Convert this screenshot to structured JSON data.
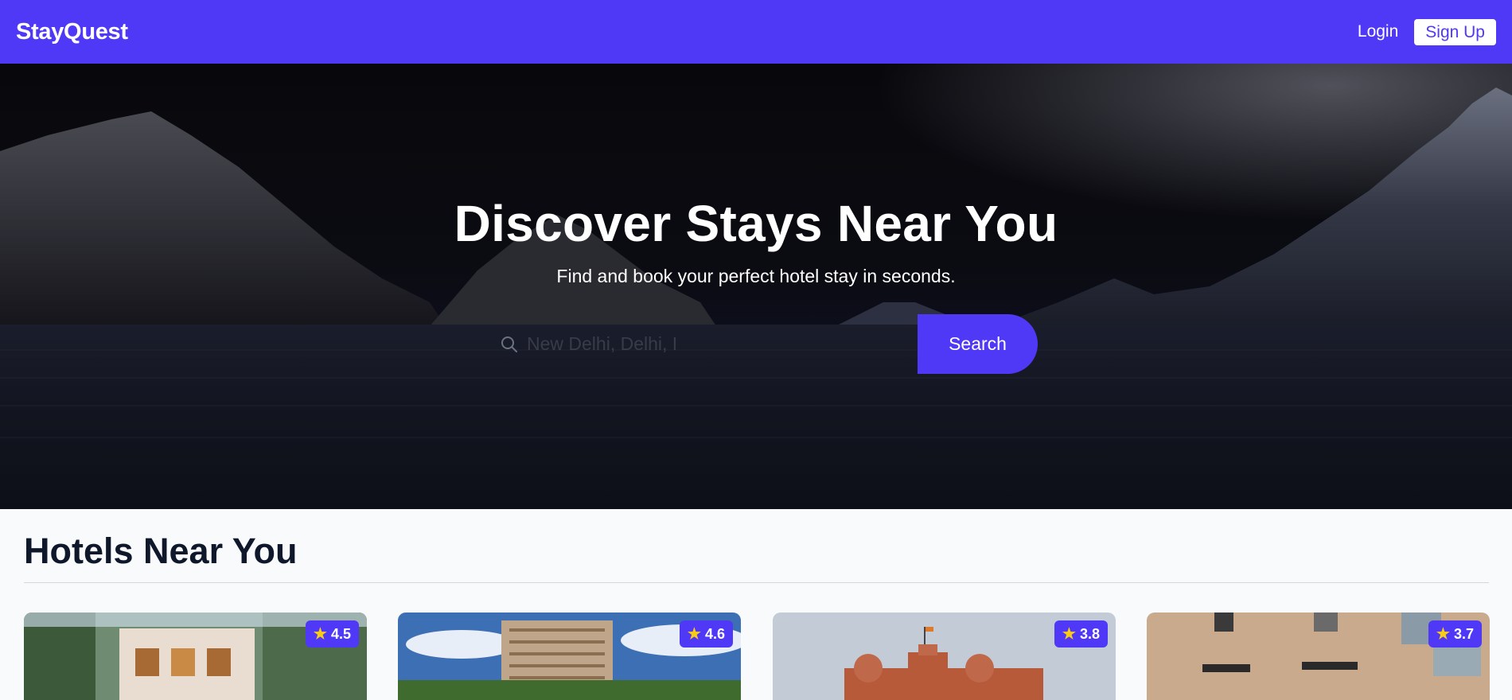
{
  "navbar": {
    "logo": "StayQuest",
    "login_label": "Login",
    "signup_label": "Sign Up",
    "brand_color": "#4f39f6"
  },
  "hero": {
    "title": "Discover Stays Near You",
    "subtitle": "Find and book your perfect hotel stay in seconds.",
    "search": {
      "placeholder": "New Delhi, Delhi, I",
      "icon": "search-icon",
      "button_label": "Search"
    }
  },
  "hotels_section": {
    "title": "Hotels Near You",
    "cards": [
      {
        "rating": "4.5",
        "star_icon": "star-icon"
      },
      {
        "rating": "4.6",
        "star_icon": "star-icon"
      },
      {
        "rating": "3.8",
        "star_icon": "star-icon"
      },
      {
        "rating": "3.7",
        "star_icon": "star-icon"
      }
    ]
  }
}
